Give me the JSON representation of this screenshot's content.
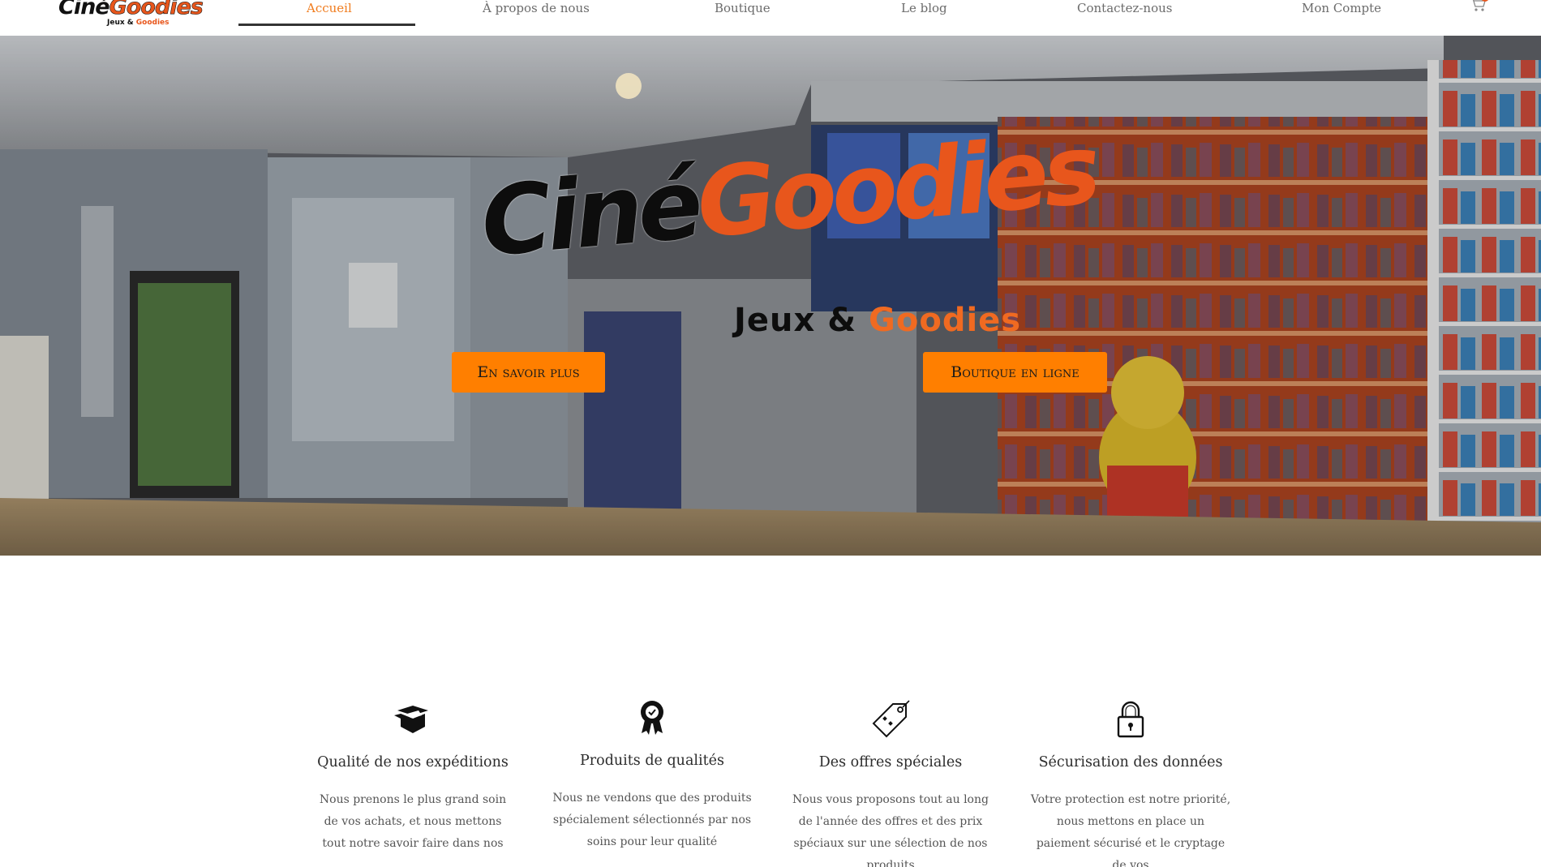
{
  "header": {
    "logo": {
      "line1_part1": "Ciné",
      "line1_part2": "Goodies",
      "line2_part1": "Jeux & ",
      "line2_part2": "Goodies"
    },
    "nav": [
      {
        "label": "Accueil",
        "active": true
      },
      {
        "label": "À propos de nous",
        "active": false
      },
      {
        "label": "Boutique",
        "active": false
      },
      {
        "label": "Le blog",
        "active": false
      },
      {
        "label": "Contactez-nous",
        "active": false
      },
      {
        "label": "Mon Compte",
        "active": false
      }
    ],
    "cart_icon": "shopping-cart-icon"
  },
  "hero": {
    "logo": {
      "line1_part1": "Ciné",
      "line1_part2": "Goodies",
      "line2_part1": "Jeux & ",
      "line2_part2": "Goodies"
    },
    "buttons": {
      "learn_more": "En savoir plus",
      "shop_online": "Boutique en ligne"
    }
  },
  "features": [
    {
      "icon": "open-box-icon",
      "title": "Qualité de nos expéditions",
      "text": "Nous prenons le plus grand soin de vos achats, et nous mettons tout notre savoir faire dans nos"
    },
    {
      "icon": "award-rosette-icon",
      "title": "Produits de qualités",
      "text": "Nous ne vendons que des produits spécialement sélectionnés par nos soins pour leur qualité"
    },
    {
      "icon": "price-tag-icon",
      "title": "Des offres spéciales",
      "text": "Nous vous proposons tout au long de l'année des offres et des prix spéciaux sur une sélection de nos produits"
    },
    {
      "icon": "padlock-icon",
      "title": "Sécurisation des données",
      "text": "Votre protection est notre priorité, nous mettons en place un paiement sécurisé et le cryptage de vos"
    }
  ],
  "colors": {
    "accent": "#ff7f00",
    "brand_orange": "#e8561c",
    "nav_active": "#f07c1e",
    "nav_text": "#6b6b6b"
  }
}
